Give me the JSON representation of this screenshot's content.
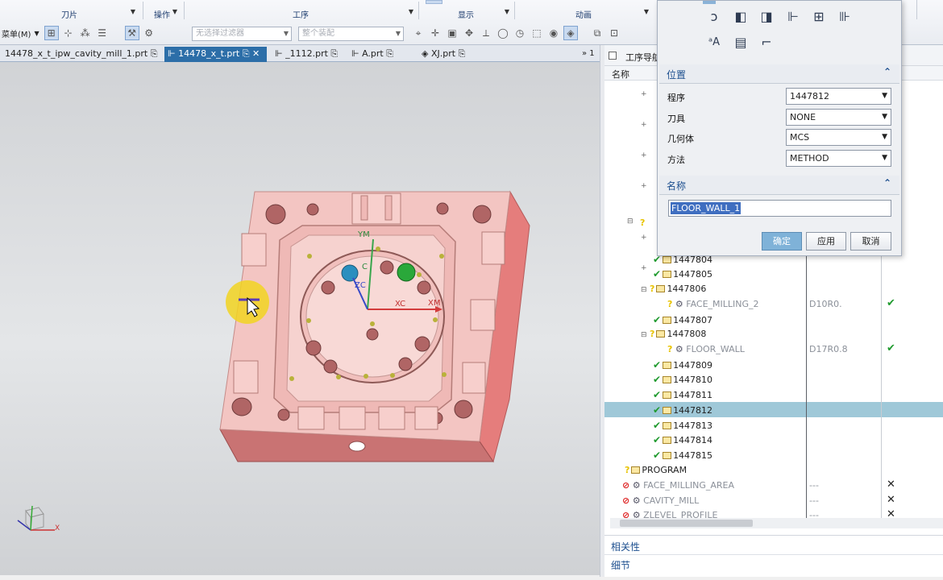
{
  "ribbon": {
    "groups": [
      "刀片",
      "操作",
      "工序",
      "显示",
      "动画"
    ],
    "menu_label": "菜单(M)",
    "filter_placeholder": "无选择过滤器",
    "assembly_placeholder": "整个装配"
  },
  "tabs": [
    {
      "label": "14478_x_t_ipw_cavity_mill_1.prt"
    },
    {
      "label": "14478_x_t.prt"
    },
    {
      "label": "_1112.prt"
    },
    {
      "label": "A.prt"
    },
    {
      "label": "XJ.prt"
    }
  ],
  "tab_overflow": "» 1",
  "viewport": {
    "axis_labels": {
      "ym": "YM",
      "xm": "XM",
      "xc": "XC",
      "zc": "ZC",
      "yc": "C"
    },
    "triad_x": "X"
  },
  "navigator": {
    "title": "工序导航器",
    "col_name": "名称",
    "rows": [
      {
        "name": "1447804",
        "tool": "",
        "status": "check"
      },
      {
        "name": "1447805",
        "tool": "",
        "status": "check"
      },
      {
        "name": "1447806",
        "tool": "",
        "status": ""
      },
      {
        "name": "FACE_MILLING_2",
        "tool": "D10R0.",
        "status": "check"
      },
      {
        "name": "1447807",
        "tool": "",
        "status": "check"
      },
      {
        "name": "1447808",
        "tool": "",
        "status": ""
      },
      {
        "name": "FLOOR_WALL",
        "tool": "D17R0.8",
        "status": "check"
      },
      {
        "name": "1447809",
        "tool": "",
        "status": "check"
      },
      {
        "name": "1447810",
        "tool": "",
        "status": "check"
      },
      {
        "name": "1447811",
        "tool": "",
        "status": "check"
      },
      {
        "name": "1447812",
        "tool": "",
        "status": "check"
      },
      {
        "name": "1447813",
        "tool": "",
        "status": "check"
      },
      {
        "name": "1447814",
        "tool": "",
        "status": "check"
      },
      {
        "name": "1447815",
        "tool": "",
        "status": "check"
      },
      {
        "name": "PROGRAM",
        "tool": "",
        "status": ""
      },
      {
        "name": "FACE_MILLING_AREA",
        "tool": "---",
        "status": "x"
      },
      {
        "name": "CAVITY_MILL",
        "tool": "---",
        "status": "x"
      },
      {
        "name": "ZLEVEL_PROFILE",
        "tool": "---",
        "status": "x"
      }
    ],
    "bottom_panels": [
      "相关性",
      "细节"
    ]
  },
  "dialog": {
    "position_section": "位置",
    "fields": [
      {
        "label": "程序",
        "value": "1447812"
      },
      {
        "label": "刀具",
        "value": "NONE"
      },
      {
        "label": "几何体",
        "value": "MCS"
      },
      {
        "label": "方法",
        "value": "METHOD"
      }
    ],
    "name_section": "名称",
    "name_value": "FLOOR_WALL_1",
    "ok_label": "确定",
    "apply_label": "应用",
    "cancel_label": "取消",
    "icon_names": [
      "mill-contour-icon",
      "mill-planar-icon",
      "drill-icon",
      "probe-icon",
      "turn-icon",
      "thread-icon",
      "text-engrave-icon",
      "document-icon",
      "tool-path-icon"
    ]
  }
}
